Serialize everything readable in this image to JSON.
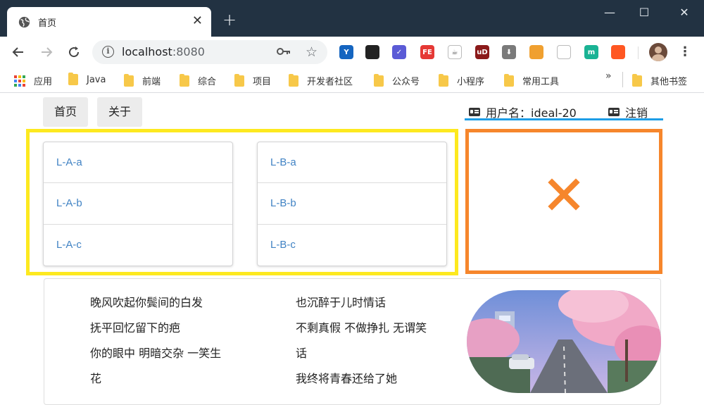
{
  "browser": {
    "tab": {
      "title": "首页",
      "close": "✕"
    },
    "new_tab": "+",
    "window_controls": {
      "minimize": "—",
      "maximize": "☐",
      "close": "✕"
    },
    "url": {
      "host": "localhost",
      "port": ":8080"
    },
    "extensions": [
      {
        "name": "ext-y",
        "label": "Y",
        "color": "#1565c0"
      },
      {
        "name": "ext-gamepad",
        "label": "",
        "color": "#222222"
      },
      {
        "name": "ext-check",
        "label": "✓",
        "color": "#5b5bd6"
      },
      {
        "name": "ext-fe",
        "label": "FE",
        "color": "#e53935"
      },
      {
        "name": "ext-java",
        "label": "☕",
        "color": "#ffffff"
      },
      {
        "name": "ext-ublock",
        "label": "uD",
        "color": "#8b1a1a"
      },
      {
        "name": "ext-download",
        "label": "⬇",
        "color": "#7a7a7a"
      },
      {
        "name": "ext-shield",
        "label": "",
        "color": "#f0a030"
      },
      {
        "name": "ext-bookmark",
        "label": "",
        "color": "#ffffff"
      },
      {
        "name": "ext-m",
        "label": "m",
        "color": "#1ab394"
      },
      {
        "name": "ext-sitemap",
        "label": "",
        "color": "#ff5722"
      }
    ]
  },
  "bookmarks": {
    "apps": "应用",
    "folders": [
      "Java",
      "前端",
      "综合",
      "项目",
      "开发者社区",
      "公众号",
      "小程序",
      "常用工具"
    ],
    "more": "»",
    "other": "其他书签"
  },
  "page": {
    "menu": {
      "home": "首页",
      "about": "关于"
    },
    "user": {
      "username": "用户名：ideal-20",
      "logout": "注销",
      "underline_color": "#1e9de6"
    },
    "list_a": [
      "L-A-a",
      "L-A-b",
      "L-A-c"
    ],
    "list_b": [
      "L-B-a",
      "L-B-b",
      "L-B-c"
    ],
    "highlight_colors": {
      "yellow": "#fde91f",
      "orange": "#f6862c"
    },
    "lyrics": {
      "left": [
        "晚风吹起你鬓间的白发",
        "抚平回忆留下的疤",
        "你的眼中 明暗交杂 一笑生",
        "花"
      ],
      "right": [
        "也沉醉于儿时情话",
        "不剩真假 不做挣扎 无谓笑",
        "话",
        "我终将青春还给了她"
      ]
    }
  }
}
